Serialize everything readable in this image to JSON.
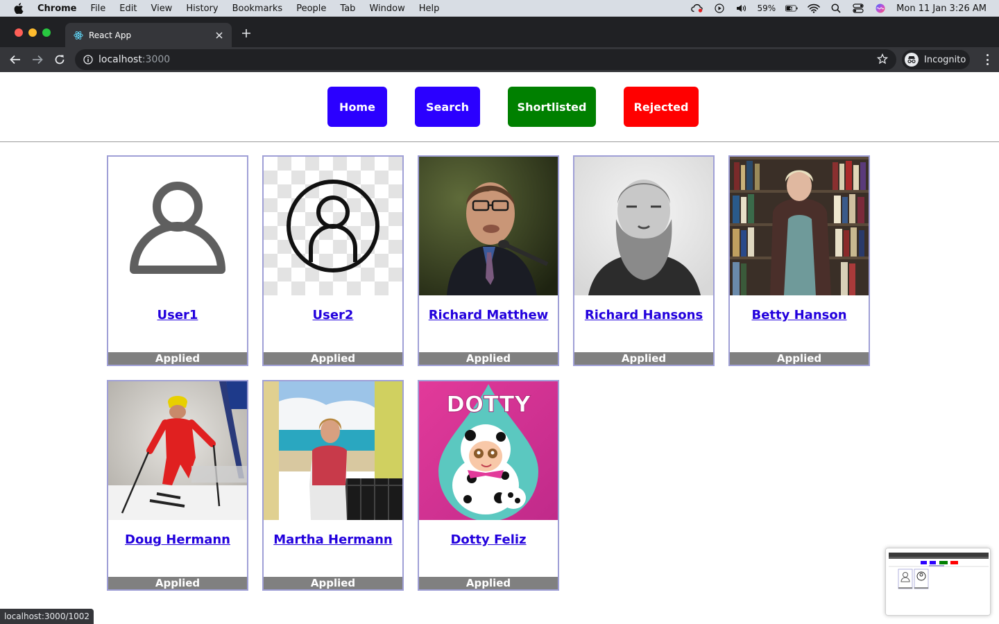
{
  "menubar": {
    "app": "Chrome",
    "items": [
      "File",
      "Edit",
      "View",
      "History",
      "Bookmarks",
      "People",
      "Tab",
      "Window",
      "Help"
    ],
    "battery": "59%",
    "datetime": "Mon 11 Jan  3:26 AM"
  },
  "browser": {
    "tab_title": "React App",
    "url_host": "localhost",
    "url_port": ":3000",
    "profile_label": "Incognito",
    "hover_link": "localhost:3000/1002"
  },
  "nav": {
    "home": "Home",
    "search": "Search",
    "shortlisted": "Shortlisted",
    "rejected": "Rejected"
  },
  "colors": {
    "home": "#2b00ff",
    "search": "#2b00ff",
    "shortlisted": "#008000",
    "rejected": "#ff0000"
  },
  "cards": [
    {
      "name": "User1",
      "status": "Applied",
      "photo": "generic-user-icon"
    },
    {
      "name": "User2",
      "status": "Applied",
      "photo": "circle-user-icon"
    },
    {
      "name": "Richard Matthew",
      "status": "Applied",
      "photo": "man-speaking-photo"
    },
    {
      "name": "Richard Hansons",
      "status": "Applied",
      "photo": "old-bearded-man-photo"
    },
    {
      "name": "Betty Hanson",
      "status": "Applied",
      "photo": "woman-bookshelf-photo"
    },
    {
      "name": "Doug Hermann",
      "status": "Applied",
      "photo": "skier-photo"
    },
    {
      "name": "Martha Hermann",
      "status": "Applied",
      "photo": "woman-balcony-photo"
    },
    {
      "name": "Dotty Feliz",
      "status": "Applied",
      "photo": "dotty-cartoon-photo"
    }
  ],
  "dotty_logo_text": "DOTTY"
}
